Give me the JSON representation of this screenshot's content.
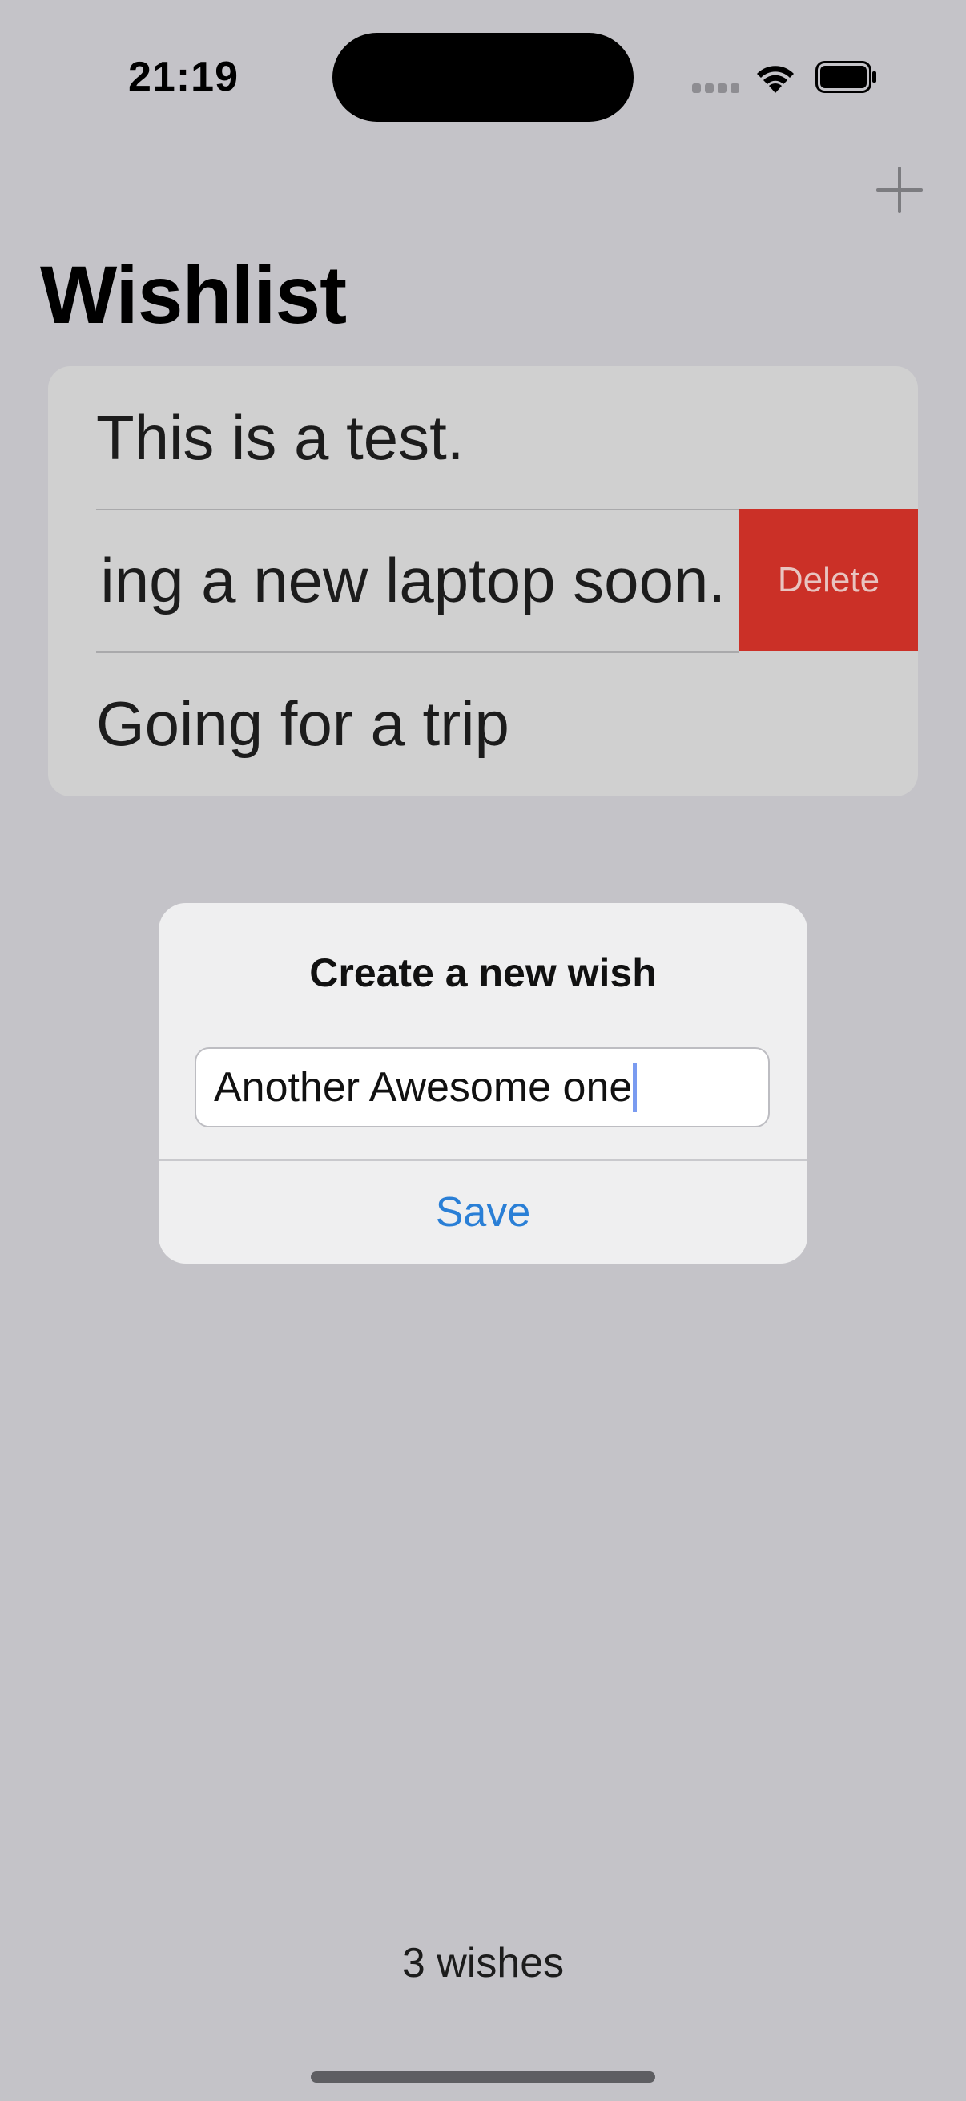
{
  "status_bar": {
    "time": "21:19"
  },
  "nav": {
    "title": "Wishlist",
    "add_icon": "plus-icon"
  },
  "wishes": {
    "row1": "This is a test.",
    "row2": "ing a new laptop soon.",
    "row3": "Going for a trip",
    "delete_label": "Delete"
  },
  "alert": {
    "title": "Create a new wish",
    "input_value": "Another Awesome one",
    "save_label": "Save"
  },
  "footer": {
    "count_label": "3 wishes"
  },
  "colors": {
    "delete": "#cb3027",
    "accent": "#2a7fd6",
    "background": "#c4c3c8"
  }
}
